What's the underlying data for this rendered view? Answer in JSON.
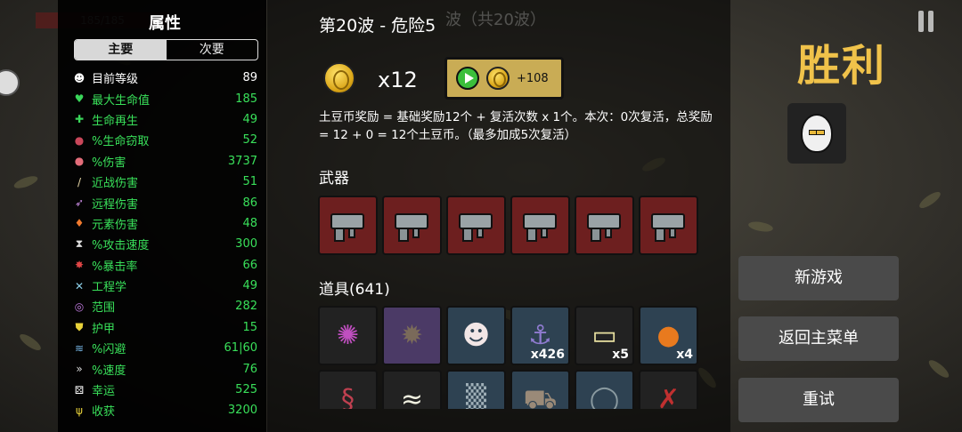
{
  "hud": {
    "hp_ghost": "185/185",
    "pause_icon": "pause-icon"
  },
  "stats": {
    "title": "属性",
    "tabs": [
      {
        "label": "主要"
      },
      {
        "label": "次要"
      }
    ],
    "rows": [
      {
        "icon": "level-icon",
        "glyph": "☻",
        "color": "#ffffff",
        "label": "目前等级",
        "value": "89",
        "green": false
      },
      {
        "icon": "heart-icon",
        "glyph": "♥",
        "color": "#3ad65a",
        "label": "最大生命值",
        "value": "185",
        "green": true
      },
      {
        "icon": "regen-icon",
        "glyph": "✚",
        "color": "#3ad65a",
        "label": "生命再生",
        "value": "49",
        "green": true
      },
      {
        "icon": "lifesteal-icon",
        "glyph": "●",
        "color": "#c9475a",
        "label": "%生命窃取",
        "value": "52",
        "green": true
      },
      {
        "icon": "damage-icon",
        "glyph": "●",
        "color": "#e36d7a",
        "label": "%伤害",
        "value": "3737",
        "green": true
      },
      {
        "icon": "melee-icon",
        "glyph": "/",
        "color": "#e8d8a8",
        "label": "近战伤害",
        "value": "51",
        "green": true
      },
      {
        "icon": "ranged-icon",
        "glyph": "➶",
        "color": "#c789e0",
        "label": "远程伤害",
        "value": "86",
        "green": true
      },
      {
        "icon": "elemental-icon",
        "glyph": "♦",
        "color": "#f07a2e",
        "label": "元素伤害",
        "value": "48",
        "green": true
      },
      {
        "icon": "attack-speed-icon",
        "glyph": "⧗",
        "color": "#dddddd",
        "label": "%攻击速度",
        "value": "300",
        "green": true
      },
      {
        "icon": "crit-icon",
        "glyph": "✸",
        "color": "#e04646",
        "label": "%暴击率",
        "value": "66",
        "green": true
      },
      {
        "icon": "engineering-icon",
        "glyph": "✕",
        "color": "#8ccfe8",
        "label": "工程学",
        "value": "49",
        "green": true
      },
      {
        "icon": "range-icon",
        "glyph": "◎",
        "color": "#c27be0",
        "label": "范围",
        "value": "282",
        "green": true
      },
      {
        "icon": "armor-icon",
        "glyph": "⛊",
        "color": "#e8d23a",
        "label": "护甲",
        "value": "15",
        "green": true
      },
      {
        "icon": "dodge-icon",
        "glyph": "≋",
        "color": "#78b8e8",
        "label": "%闪避",
        "value": "61|60",
        "green": true
      },
      {
        "icon": "speed-icon",
        "glyph": "»",
        "color": "#dddddd",
        "label": "%速度",
        "value": "76",
        "green": true
      },
      {
        "icon": "luck-icon",
        "glyph": "⚄",
        "color": "#ffffff",
        "label": "幸运",
        "value": "525",
        "green": true
      },
      {
        "icon": "harvest-icon",
        "glyph": "ψ",
        "color": "#e8d23a",
        "label": "收获",
        "value": "3200",
        "green": true
      }
    ]
  },
  "center": {
    "wave_title": "第20波 - 危险5",
    "wave_ghost": "波（共20波）",
    "coin_count": "x12",
    "bonus_label": "+108",
    "description": "土豆币奖励 = 基础奖励12个 + 复活次数 x 1个。本次：0次复活，总奖励 = 12 + 0 = 12个土豆币。（最多加成5次复活）",
    "weapons_label": "武器",
    "weapons": [
      {
        "name": "pistol"
      },
      {
        "name": "pistol"
      },
      {
        "name": "pistol"
      },
      {
        "name": "pistol"
      },
      {
        "name": "pistol"
      },
      {
        "name": "pistol"
      }
    ],
    "items_label": "道具(641)",
    "items": [
      {
        "icon": "tentacle-icon",
        "glyph": "✺",
        "color": "#c04fc0",
        "bg": "item",
        "qty": ""
      },
      {
        "icon": "mine-icon",
        "glyph": "✹",
        "color": "#7a6a5a",
        "bg": "item purple",
        "qty": ""
      },
      {
        "icon": "clown-mask-icon",
        "glyph": "☻",
        "color": "#f2e6e6",
        "bg": "item blue",
        "qty": ""
      },
      {
        "icon": "fishing-rod-icon",
        "glyph": "⚓",
        "color": "#8f7bd0",
        "bg": "item blue",
        "qty": "x426"
      },
      {
        "icon": "banknote-icon",
        "glyph": "▭",
        "color": "#e8e0a0",
        "bg": "item",
        "qty": "x5"
      },
      {
        "icon": "pumpkin-icon",
        "glyph": "●",
        "color": "#e87a1e",
        "bg": "item blue",
        "qty": "x4"
      },
      {
        "icon": "worm-icon",
        "glyph": "§",
        "color": "#c04050",
        "bg": "item",
        "qty": ""
      },
      {
        "icon": "lizard-icon",
        "glyph": "≈",
        "color": "#f0f0e0",
        "bg": "item",
        "qty": ""
      },
      {
        "icon": "net-icon",
        "glyph": "▒",
        "color": "#a0b0b8",
        "bg": "item blue",
        "qty": ""
      },
      {
        "icon": "cart-icon",
        "glyph": "⛟",
        "color": "#9a8a78",
        "bg": "item blue",
        "qty": ""
      },
      {
        "icon": "belt-icon",
        "glyph": "◯",
        "color": "#8a9aa0",
        "bg": "item blue",
        "qty": ""
      },
      {
        "icon": "branch-icon",
        "glyph": "✗",
        "color": "#c03030",
        "bg": "item",
        "qty": ""
      }
    ]
  },
  "right": {
    "victory": "胜利",
    "buttons": {
      "new_game": "新游戏",
      "main_menu": "返回主菜单",
      "retry": "重试"
    }
  }
}
